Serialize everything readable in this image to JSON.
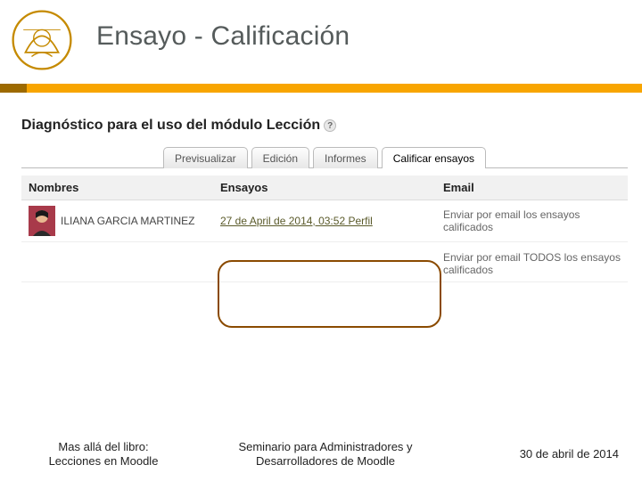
{
  "slide": {
    "title": "Ensayo - Calificación"
  },
  "moodle": {
    "lesson_title": "Diagnóstico para el uso del módulo Lección",
    "tabs": [
      {
        "label": "Previsualizar"
      },
      {
        "label": "Edición"
      },
      {
        "label": "Informes"
      },
      {
        "label": "Calificar ensayos"
      }
    ],
    "columns": {
      "names": "Nombres",
      "essays": "Ensayos",
      "email": "Email"
    },
    "rows": [
      {
        "student": "ILIANA GARCIA MARTINEZ",
        "essay_link": "27 de April de 2014, 03:52 Perfil",
        "email_action": "Enviar por email los ensayos calificados"
      }
    ],
    "bulk_email": "Enviar por email TODOS los ensayos calificados"
  },
  "footer": {
    "left_line1": "Mas allá del libro:",
    "left_line2": "Lecciones en Moodle",
    "mid_line1": "Seminario para Administradores y",
    "mid_line2": "Desarrolladores de Moodle",
    "right": "30 de abril de 2014"
  }
}
